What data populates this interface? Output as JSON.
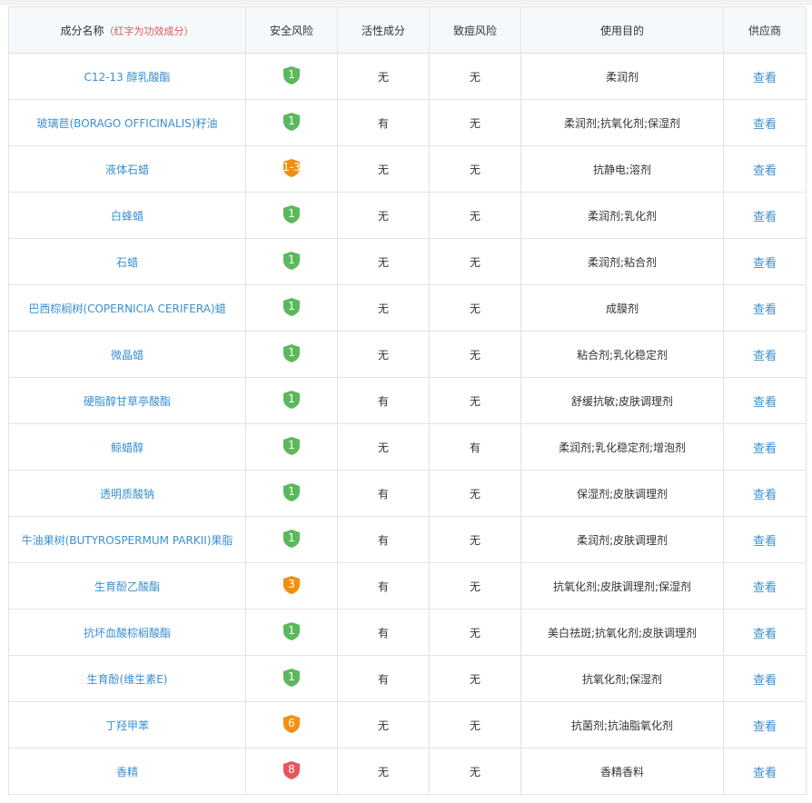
{
  "header": {
    "name": "成分名称",
    "note": "（红字为功效成分）",
    "safety": "安全风险",
    "active": "活性成分",
    "acne": "致痘风险",
    "purpose": "使用目的",
    "supplier": "供应商"
  },
  "colors": {
    "green": "#5cb85c",
    "orange": "#f0900f",
    "red": "#e9555a",
    "link": "#3b8fd0"
  },
  "rows": [
    {
      "name": "C12-13 醇乳酸酯",
      "risk": "1",
      "level": "green",
      "active": "无",
      "acne": "无",
      "purpose": "柔润剂",
      "supplier": "查看"
    },
    {
      "name": "玻璃苣(BORAGO OFFICINALIS)籽油",
      "risk": "1",
      "level": "green",
      "active": "有",
      "acne": "无",
      "purpose": "柔润剂;抗氧化剂;保湿剂",
      "supplier": "查看"
    },
    {
      "name": "液体石蜡",
      "risk": "1-3",
      "level": "orange",
      "active": "无",
      "acne": "无",
      "purpose": "抗静电;溶剂",
      "supplier": "查看"
    },
    {
      "name": "白蜂蜡",
      "risk": "1",
      "level": "green",
      "active": "无",
      "acne": "无",
      "purpose": "柔润剂;乳化剂",
      "supplier": "查看"
    },
    {
      "name": "石蜡",
      "risk": "1",
      "level": "green",
      "active": "无",
      "acne": "无",
      "purpose": "柔润剂;粘合剂",
      "supplier": "查看"
    },
    {
      "name": "巴西棕榈树(COPERNICIA CERIFERA)蜡",
      "risk": "1",
      "level": "green",
      "active": "无",
      "acne": "无",
      "purpose": "成膜剂",
      "supplier": "查看"
    },
    {
      "name": "微晶蜡",
      "risk": "1",
      "level": "green",
      "active": "无",
      "acne": "无",
      "purpose": "粘合剂;乳化稳定剂",
      "supplier": "查看"
    },
    {
      "name": "硬脂醇甘草亭酸酯",
      "risk": "1",
      "level": "green",
      "active": "有",
      "acne": "无",
      "purpose": "舒缓抗敏;皮肤调理剂",
      "supplier": "查看"
    },
    {
      "name": "鲸蜡醇",
      "risk": "1",
      "level": "green",
      "active": "无",
      "acne": "有",
      "purpose": "柔润剂;乳化稳定剂;增泡剂",
      "supplier": "查看"
    },
    {
      "name": "透明质酸钠",
      "risk": "1",
      "level": "green",
      "active": "有",
      "acne": "无",
      "purpose": "保湿剂;皮肤调理剂",
      "supplier": "查看"
    },
    {
      "name": "牛油果树(BUTYROSPERMUM PARKII)果脂",
      "risk": "1",
      "level": "green",
      "active": "有",
      "acne": "无",
      "purpose": "柔润剂;皮肤调理剂",
      "supplier": "查看"
    },
    {
      "name": "生育酚乙酸酯",
      "risk": "3",
      "level": "orange",
      "active": "有",
      "acne": "无",
      "purpose": "抗氧化剂;皮肤调理剂;保湿剂",
      "supplier": "查看"
    },
    {
      "name": "抗坏血酸棕榈酸酯",
      "risk": "1",
      "level": "green",
      "active": "有",
      "acne": "无",
      "purpose": "美白祛斑;抗氧化剂;皮肤调理剂",
      "supplier": "查看"
    },
    {
      "name": "生育酚(维生素E)",
      "risk": "1",
      "level": "green",
      "active": "有",
      "acne": "无",
      "purpose": "抗氧化剂;保湿剂",
      "supplier": "查看"
    },
    {
      "name": "丁羟甲苯",
      "risk": "6",
      "level": "orange",
      "active": "无",
      "acne": "无",
      "purpose": "抗菌剂;抗油脂氧化剂",
      "supplier": "查看"
    },
    {
      "name": "香精",
      "risk": "8",
      "level": "red",
      "active": "无",
      "acne": "无",
      "purpose": "香精香料",
      "supplier": "查看"
    }
  ]
}
